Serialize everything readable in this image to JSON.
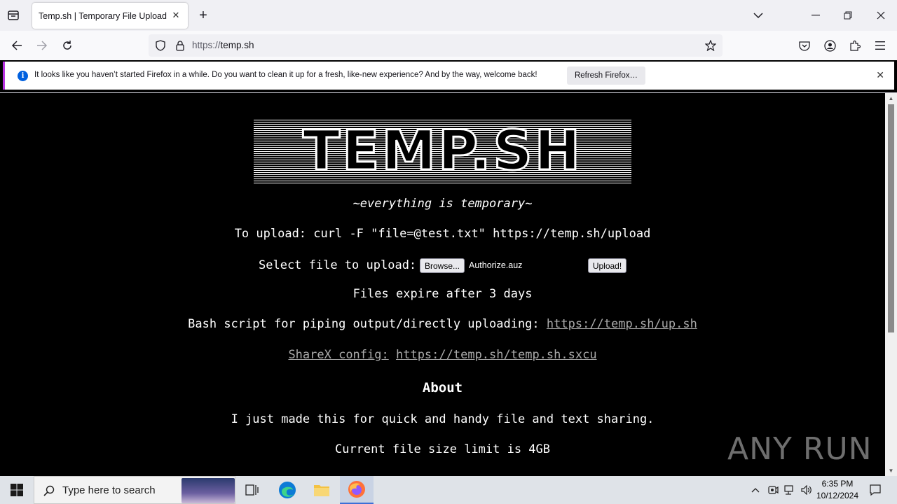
{
  "browser": {
    "tab_title": "Temp.sh | Temporary File Upload",
    "url_scheme": "https://",
    "url_host": "temp.sh",
    "notification": {
      "text": "It looks like you haven’t started Firefox in a while. Do you want to clean it up for a fresh, like-new experience? And by the way, welcome back!",
      "button": "Refresh Firefox…"
    }
  },
  "page": {
    "logo_text": "TEMP.SH",
    "tagline": "~everything is temporary~",
    "upload_cmd": "To upload: curl -F \"file=@test.txt\" https://temp.sh/upload",
    "select_label": "Select file to upload:",
    "browse_button": "Browse...",
    "selected_file": "Authorize.auz",
    "upload_button": "Upload!",
    "expiry": "Files expire after 3 days",
    "bash_label": "Bash script for piping output/directly uploading:",
    "bash_link": "https://temp.sh/up.sh",
    "sharex_label": "ShareX config:",
    "sharex_link": "https://temp.sh/temp.sh.sxcu",
    "about_heading": "About",
    "about_text": "I just made this for quick and handy file and text sharing.",
    "size_limit": "Current file size limit is 4GB"
  },
  "watermark": "ANY RUN",
  "taskbar": {
    "search_placeholder": "Type here to search",
    "time": "6:35 PM",
    "date": "10/12/2024"
  },
  "colors": {
    "page_bg": "#000000",
    "page_text": "#ffffff",
    "link": "#aaaaaa",
    "firefox_accent": "#b833e1",
    "info_blue": "#0060df"
  }
}
